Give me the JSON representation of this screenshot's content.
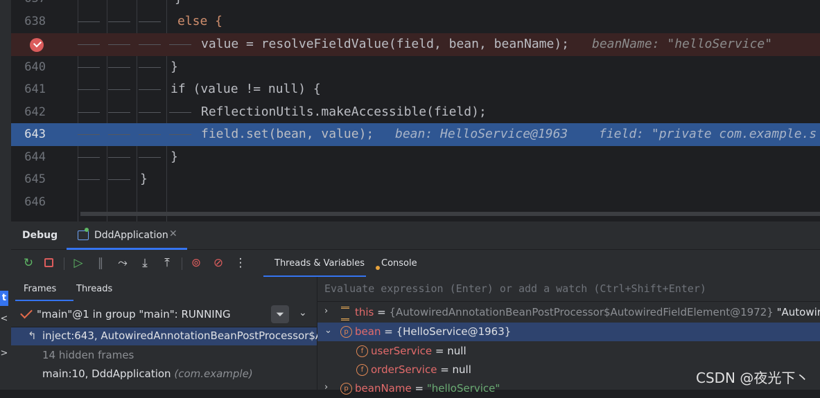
{
  "editor": {
    "lines": [
      {
        "num": "638",
        "code": "else {"
      },
      {
        "num": "",
        "code": "value = resolveFieldValue(field, bean, beanName);",
        "inline": "beanName: \"helloService\""
      },
      {
        "num": "640",
        "code": "}"
      },
      {
        "num": "641",
        "code": "if (value != null) {"
      },
      {
        "num": "642",
        "code": "ReflectionUtils.makeAccessible(field);"
      },
      {
        "num": "643",
        "code": "field.set(bean, value);",
        "inline1": "bean: HelloService@1963",
        "inline2": "field: \"private com.example.s"
      },
      {
        "num": "644",
        "code": "}"
      },
      {
        "num": "645",
        "code": "}"
      },
      {
        "num": "646",
        "code": ""
      }
    ]
  },
  "debug": {
    "title": "Debug",
    "run_tab": "DddApplication",
    "tabs": {
      "threads_vars": "Threads & Variables",
      "console": "Console"
    },
    "left_tabs": {
      "frames": "Frames",
      "threads": "Threads"
    },
    "thread": "\"main\"@1 in group \"main\": RUNNING",
    "frames": [
      {
        "label": "inject:643, AutowiredAnnotationBeanPostProcessor$A"
      },
      {
        "label": "14 hidden frames"
      },
      {
        "label": "main:10, DddApplication",
        "pkg": "(com.example)"
      }
    ],
    "evaluate_placeholder": "Evaluate expression (Enter) or add a watch (Ctrl+Shift+Enter)",
    "variables": [
      {
        "name": "this",
        "value": "{AutowiredAnnotationBeanPostProcessor$AutowiredFieldElement@1972}",
        "extra": "\"Autowired"
      },
      {
        "name": "bean",
        "value": "{HelloService@1963}"
      },
      {
        "name": "userService",
        "value": "null"
      },
      {
        "name": "orderService",
        "value": "null"
      },
      {
        "name": "beanName",
        "value": "\"helloService\""
      }
    ]
  },
  "watermark": "CSDN @夜光下丶",
  "colors": {
    "accent": "#3574f0",
    "selected_line": "#2f5692",
    "breakpoint": "#db5c5c"
  }
}
